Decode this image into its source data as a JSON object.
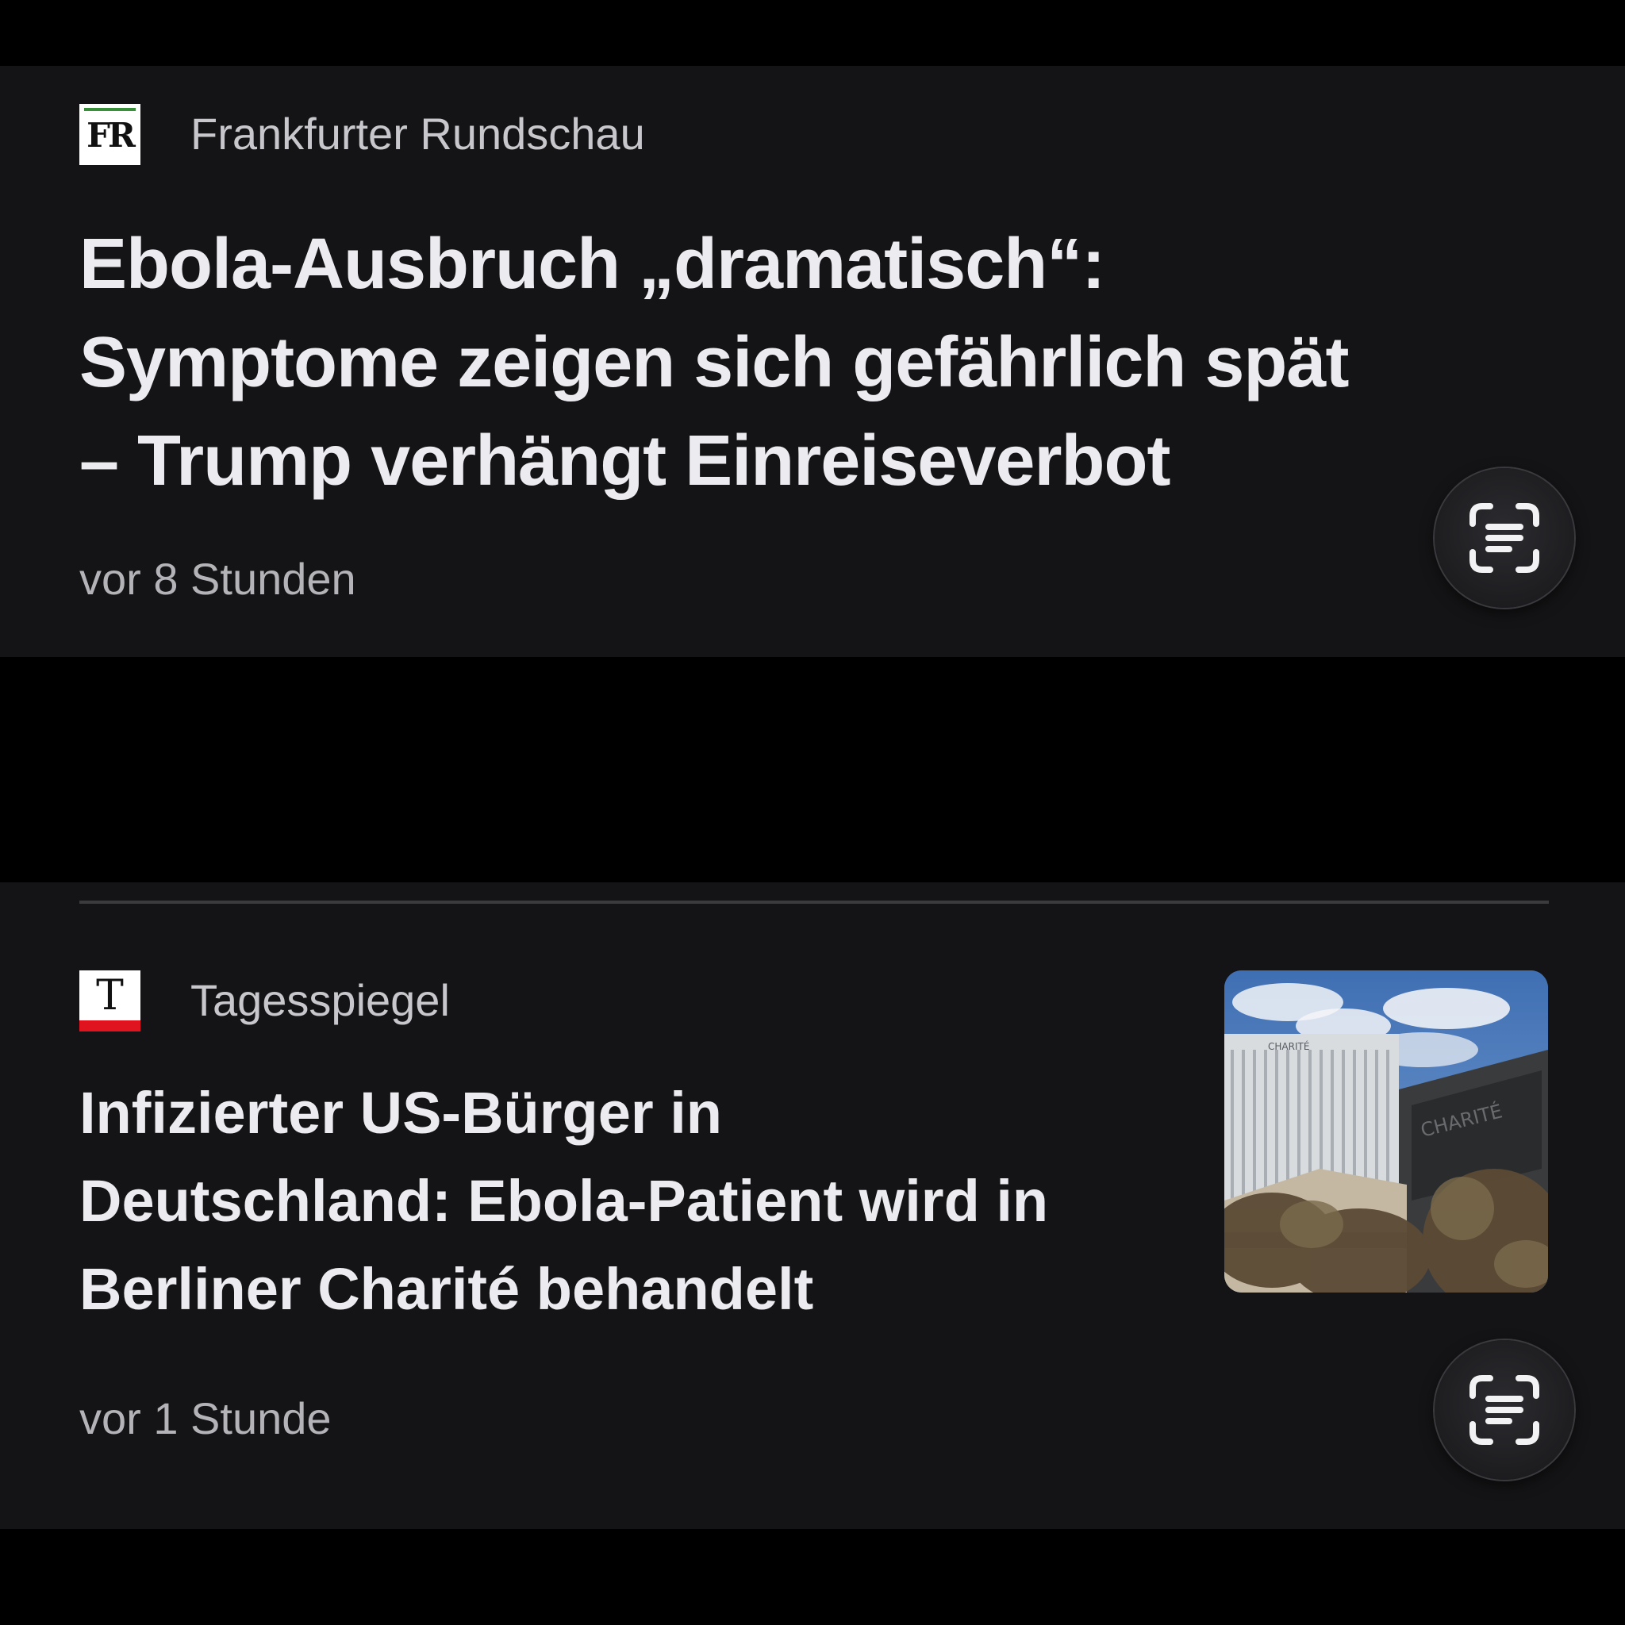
{
  "articles": [
    {
      "publisher": "Frankfurter Rundschau",
      "logo_text": "FR",
      "headline_lines": [
        "Ebola-Ausbruch „dramatisch“:",
        "Symptome zeigen sich gefährlich spät",
        "– Trump verhängt Einreiseverbot"
      ],
      "time": "vor 8 Stunden",
      "has_image": false
    },
    {
      "publisher": "Tagesspiegel",
      "logo_text": "T",
      "headline_lines": [
        "Infizierter US-Bürger in",
        "Deutschland: Ebola-Patient wird in",
        "Berliner Charité behandelt"
      ],
      "time": "vor 1 Stunde",
      "has_image": true,
      "image_signs": [
        "CHARITÉ",
        "CHARITÉ"
      ]
    }
  ],
  "icons": {
    "card_action": "text-scan-icon"
  },
  "colors": {
    "page_background": "#000000",
    "card_background": "#141416",
    "headline_text": "#ececf0",
    "meta_text": "#b4b4b8",
    "fr_logo_accent": "#3a8f3a",
    "tagesspiegel_logo_accent": "#e0141e"
  }
}
